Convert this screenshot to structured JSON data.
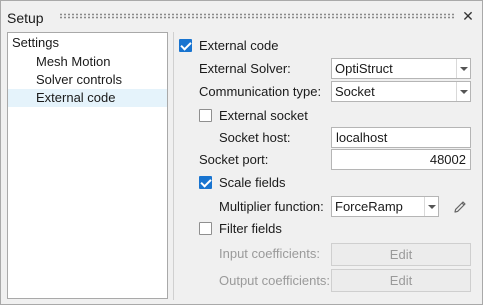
{
  "window": {
    "title": "Setup",
    "close_label": "✕"
  },
  "tree": {
    "header": "Settings",
    "items": [
      {
        "label": "Mesh Motion"
      },
      {
        "label": "Solver controls"
      },
      {
        "label": "External code"
      }
    ]
  },
  "panel": {
    "external_code": {
      "label": "External code",
      "checked": true
    },
    "external_solver": {
      "label": "External Solver:",
      "value": "OptiStruct"
    },
    "communication_type": {
      "label": "Communication type:",
      "value": "Socket"
    },
    "external_socket": {
      "label": "External socket",
      "checked": false
    },
    "socket_host": {
      "label": "Socket host:",
      "value": "localhost"
    },
    "socket_port": {
      "label": "Socket port:",
      "value": "48002"
    },
    "scale_fields": {
      "label": "Scale fields",
      "checked": true
    },
    "multiplier_function": {
      "label": "Multiplier function:",
      "value": "ForceRamp"
    },
    "filter_fields": {
      "label": "Filter fields",
      "checked": false
    },
    "input_coefficients": {
      "label": "Input coefficients:",
      "button": "Edit"
    },
    "output_coefficients": {
      "label": "Output coefficients:",
      "button": "Edit"
    }
  },
  "colors": {
    "accent": "#1874d0",
    "selection": "#e5f3fb",
    "disabled_text": "#9a9a9a"
  },
  "icons": {
    "edit": "pencil-icon",
    "close": "close-icon",
    "dropdown": "chevron-down-icon"
  }
}
